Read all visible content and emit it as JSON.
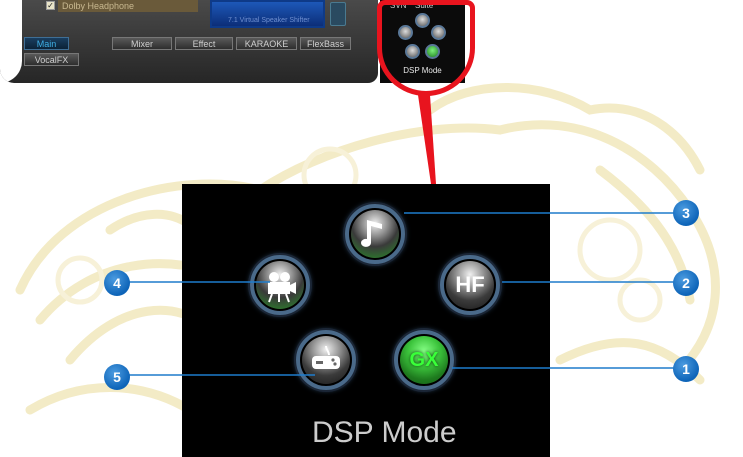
{
  "panel": {
    "dolby_label": "Dolby Headphone",
    "lcd_text": "7.1 Virtual Speaker Shifter",
    "tabs": [
      "Main",
      "Mixer",
      "Effect",
      "KARAOKE",
      "FlexBass",
      "VocalFX"
    ],
    "active_tab": "Main"
  },
  "mini_dsp": {
    "label_left": "SVN",
    "label_right": "Suite",
    "label": "DSP Mode"
  },
  "dsp": {
    "label": "DSP Mode",
    "buttons": {
      "music": {
        "icon": "music-note-icon",
        "number": "3"
      },
      "hifi": {
        "icon": "hf-icon",
        "text": "HF",
        "number": "2"
      },
      "movie": {
        "icon": "movie-camera-icon",
        "number": "4"
      },
      "game": {
        "icon": "gamepad-icon",
        "number": "5"
      },
      "gx": {
        "icon": "gx-icon",
        "text": "GX",
        "number": "1"
      }
    }
  },
  "colors": {
    "callout_blue": "#0d64b8",
    "highlight_red": "#e8141e",
    "active_green": "#3cc43c"
  }
}
